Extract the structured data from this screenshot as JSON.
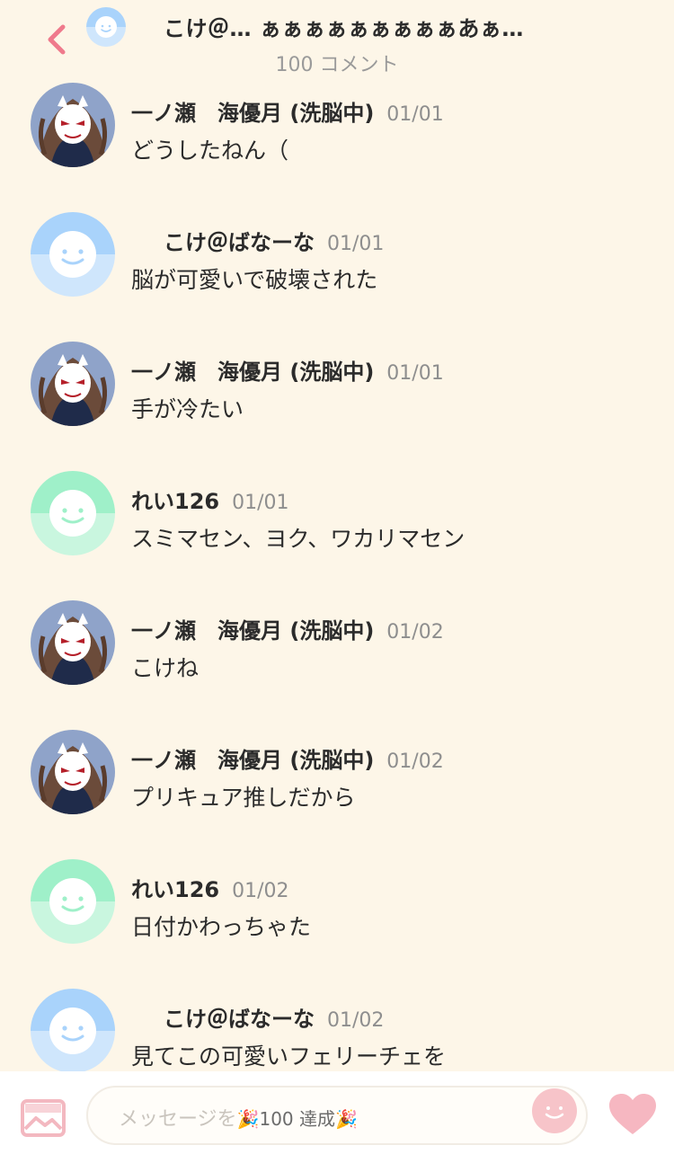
{
  "header": {
    "title": "こけ＠… ぁぁぁぁぁぁぁぁぁあぁ…",
    "comment_count": "100 コメント",
    "back_icon": "chevron-left-icon",
    "accent_color": "#ef7a8c"
  },
  "messages": [
    {
      "name": "一ノ瀬　海優月 (洗脳中)",
      "date": "01/01",
      "text": "どうしたねん（",
      "avatar": "character-avatar"
    },
    {
      "name": "こけ＠ばなーな",
      "date": "01/01",
      "text": "脳が可愛いで破壊された",
      "avatar": "default-avatar-blue"
    },
    {
      "name": "一ノ瀬　海優月 (洗脳中)",
      "date": "01/01",
      "text": "手が冷たい",
      "avatar": "character-avatar"
    },
    {
      "name": "れい126",
      "date": "01/01",
      "text": "スミマセン、ヨク、ワカリマセン",
      "avatar": "default-avatar-green"
    },
    {
      "name": "一ノ瀬　海優月 (洗脳中)",
      "date": "01/02",
      "text": "こけね",
      "avatar": "character-avatar"
    },
    {
      "name": "一ノ瀬　海優月 (洗脳中)",
      "date": "01/02",
      "text": "プリキュア推しだから",
      "avatar": "character-avatar"
    },
    {
      "name": "れい126",
      "date": "01/02",
      "text": "日付かわっちゃた",
      "avatar": "default-avatar-green"
    },
    {
      "name": "こけ＠ばなーな",
      "date": "01/02",
      "text": "見てこの可愛いフェリーチェを",
      "avatar": "default-avatar-blue"
    }
  ],
  "composer": {
    "placeholder": "メッセージを",
    "badge": "🎉100 達成🎉",
    "image_icon": "image-icon",
    "emoji_icon": "smiley-icon",
    "heart_icon": "heart-icon"
  }
}
